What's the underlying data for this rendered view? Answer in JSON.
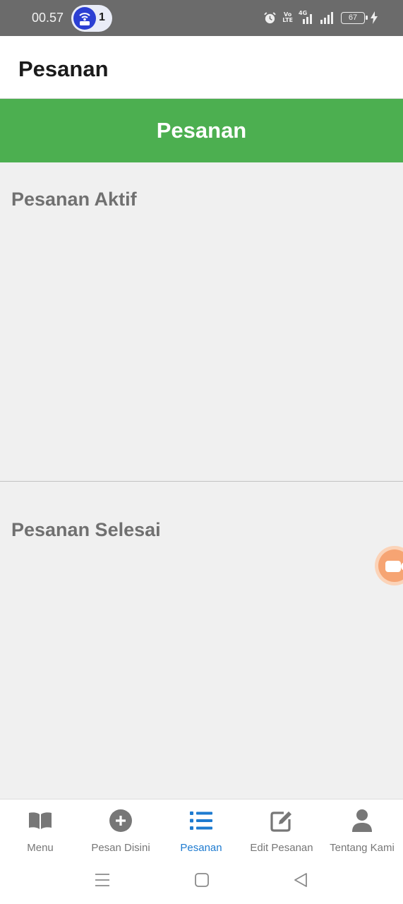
{
  "status_bar": {
    "time": "00.57",
    "hotspot_count": "1",
    "volte_line1": "Vo",
    "volte_line2": "LTE",
    "network_type": "4G",
    "battery_level": "67",
    "icons": [
      "hotspot-icon",
      "alarm-icon",
      "volte-icon",
      "signal-icon",
      "signal-icon",
      "battery-icon",
      "charging-icon"
    ]
  },
  "app_bar": {
    "title": "Pesanan"
  },
  "banner": {
    "title": "Pesanan",
    "color": "#4caf50"
  },
  "sections": {
    "active": {
      "title": "Pesanan Aktif"
    },
    "done": {
      "title": "Pesanan Selesai"
    }
  },
  "floating_button": {
    "icon": "video-camera-icon",
    "color": "#f6a473"
  },
  "bottom_nav": {
    "active_color": "#1e7bd0",
    "inactive_color": "#777777",
    "items": [
      {
        "label": "Menu",
        "icon": "book-icon",
        "active": false
      },
      {
        "label": "Pesan Disini",
        "icon": "plus-circle-icon",
        "active": false
      },
      {
        "label": "Pesanan",
        "icon": "list-icon",
        "active": true
      },
      {
        "label": "Edit Pesanan",
        "icon": "edit-icon",
        "active": false
      },
      {
        "label": "Tentang Kami",
        "icon": "user-icon",
        "active": false
      }
    ]
  },
  "system_nav": {
    "icons": [
      "menu-icon",
      "home-icon",
      "back-icon"
    ]
  }
}
